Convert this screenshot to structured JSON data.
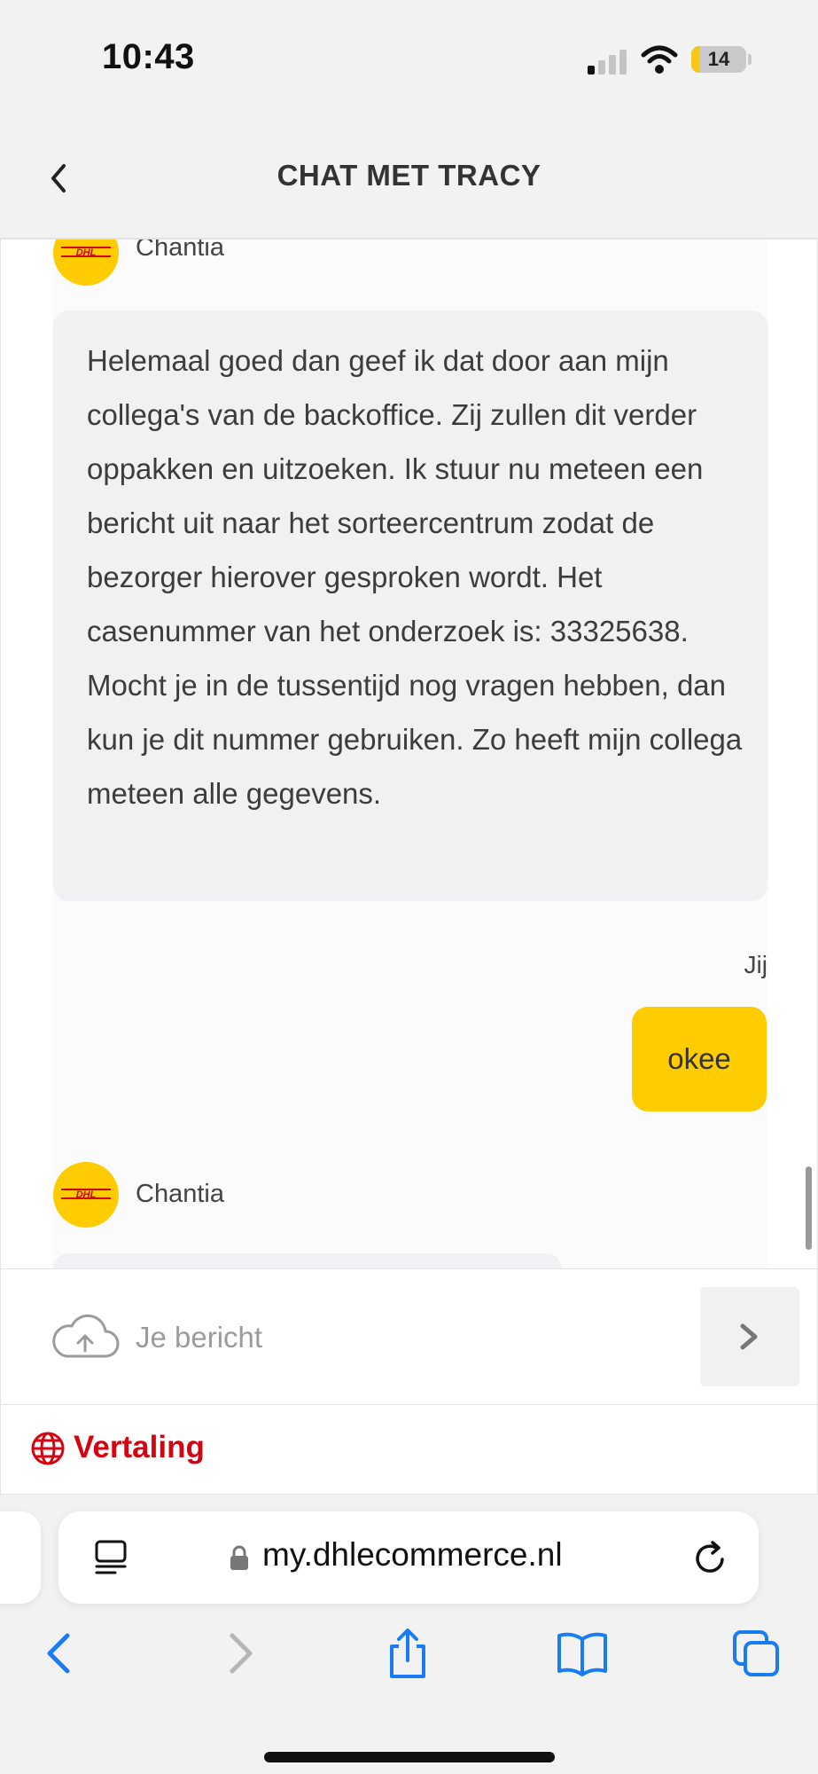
{
  "status_bar": {
    "time": "10:43",
    "battery": "14",
    "battery_level": 0.14
  },
  "header": {
    "title": "CHAT MET TRACY"
  },
  "messages": [
    {
      "sender": "Chantia",
      "type": "agent-name"
    },
    {
      "sender": "Chantia",
      "type": "agent-message",
      "text": "Helemaal goed dan geef ik dat door aan mijn collega's van de backoffice. Zij zullen dit verder oppakken en uitzoeken. Ik stuur nu meteen een bericht uit naar het sorteercentrum zodat de bezorger hierover gesproken wordt. Het casenummer van het onderzoek is: 33325638. Mocht je in de tussentijd nog vragen hebben, dan kun je dit nummer gebruiken. Zo heeft mijn collega meteen alle gegevens."
    },
    {
      "sender": "Jij",
      "type": "user-message",
      "text": "okee"
    },
    {
      "sender": "Chantia",
      "type": "agent-name"
    }
  ],
  "input": {
    "placeholder": "Je bericht",
    "value": ""
  },
  "translation": {
    "label": "Vertaling"
  },
  "browser": {
    "url": "my.dhlecommerce.nl"
  },
  "colors": {
    "dhl_yellow": "#fecc00",
    "dhl_red": "#d40511",
    "ios_blue": "#1a7cf5"
  },
  "icons": {
    "back": "chevron-left-icon",
    "upload": "cloud-upload-icon",
    "send": "chevron-right-icon",
    "translate": "globe-icon",
    "reader": "reader-mode-icon",
    "lock": "lock-icon",
    "reload": "reload-icon",
    "toolbar": [
      "back-arrow-icon",
      "forward-arrow-icon",
      "share-icon",
      "bookmarks-icon",
      "tabs-icon"
    ]
  }
}
